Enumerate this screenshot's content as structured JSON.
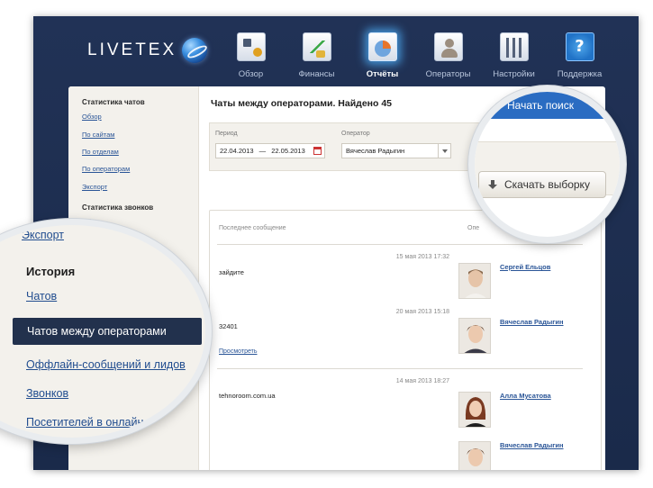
{
  "brand": {
    "logo_text": "LIVETEX"
  },
  "nav": [
    {
      "label": "Обзор",
      "icon": "overview-icon",
      "active": false
    },
    {
      "label": "Финансы",
      "icon": "finance-chart-icon",
      "active": false
    },
    {
      "label": "Отчёты",
      "icon": "reports-icon",
      "active": true
    },
    {
      "label": "Операторы",
      "icon": "operator-icon",
      "active": false
    },
    {
      "label": "Настройки",
      "icon": "settings-sliders-icon",
      "active": false
    },
    {
      "label": "Поддержка",
      "icon": "help-icon",
      "active": false
    }
  ],
  "sidebar": {
    "chat_stats_heading": "Статистика чатов",
    "chat_links": [
      "Обзор",
      "По сайтам",
      "По отделам",
      "По операторам",
      "Экспорт"
    ],
    "call_stats_heading": "Статистика звонков",
    "call_links": [
      "Обзор"
    ]
  },
  "main": {
    "title": "Чаты между операторами. Найдено 45",
    "filter": {
      "period_label": "Период",
      "date_from": "22.04.2013",
      "date_sep": "—",
      "date_to": "22.05.2013",
      "operator_label": "Оператор",
      "operator_value": "Вячеслав Радыгин"
    },
    "list": {
      "col_last_message": "Последнее сообщение",
      "col_operators": "Опе",
      "items": [
        {
          "date": "15 мая 2013 17:32",
          "text": "зайдите",
          "operator": "Сергей Ельцов",
          "view_link": ""
        },
        {
          "date": "20 мая 2013 15:18",
          "text": "32401",
          "operator": "Вячеслав Радыгин",
          "view_link": "Просмотреть"
        },
        {
          "date": "14 мая 2013 18:27",
          "text": "tehnoroom.com.ua",
          "operator": "Алла Мусатова",
          "view_link": ""
        },
        {
          "date": "",
          "text": "",
          "operator": "Вячеслав Радыгин",
          "view_link": ""
        }
      ]
    }
  },
  "magnifier_right": {
    "search_button_text": "Начать поиск",
    "download_button": "Скачать выборку"
  },
  "magnifier_left": {
    "partial_top_link": "Экспорт",
    "heading": "История",
    "links": [
      "Чатов",
      "Чатов между операторами",
      "Оффлайн-сообщений и лидов",
      "Звонков",
      "Посетителей в онлайн"
    ],
    "active_index": 1
  },
  "colors": {
    "frame_bg": "#1a2a4a",
    "link": "#2a5597",
    "active_item_bg": "#22314d",
    "search_button": "#2a6cc2",
    "sidebar_bg": "#f3f1ec"
  }
}
